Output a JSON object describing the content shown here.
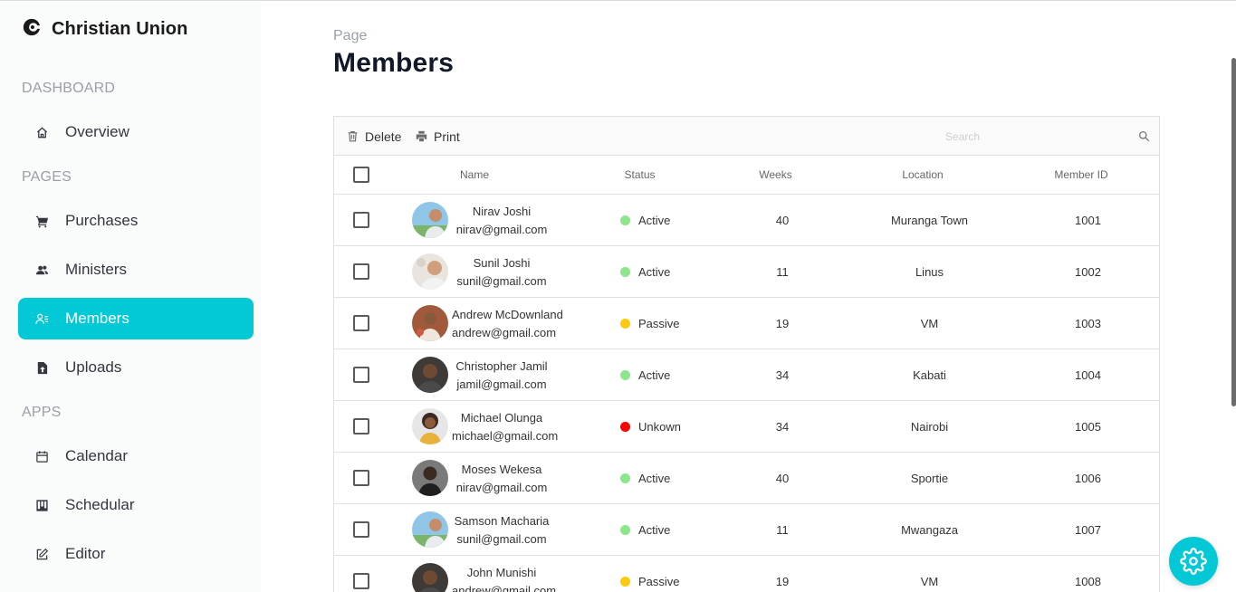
{
  "brand": {
    "name": "Christian Union",
    "icon": "logo-icon"
  },
  "sidebar": {
    "sections": [
      {
        "label": "DASHBOARD"
      },
      {
        "label": "PAGES"
      },
      {
        "label": "APPS"
      }
    ],
    "items": [
      {
        "label": "Overview",
        "icon": "home-icon"
      },
      {
        "label": "Purchases",
        "icon": "cart-icon"
      },
      {
        "label": "Ministers",
        "icon": "people-icon"
      },
      {
        "label": "Members",
        "icon": "member-list-icon",
        "active": true
      },
      {
        "label": "Uploads",
        "icon": "upload-icon"
      },
      {
        "label": "Calendar",
        "icon": "calendar-icon"
      },
      {
        "label": "Schedular",
        "icon": "kanban-icon"
      },
      {
        "label": "Editor",
        "icon": "edit-icon"
      }
    ],
    "active_color": "#03c9d7"
  },
  "header": {
    "kicker": "Page",
    "title": "Members"
  },
  "toolbar": {
    "delete_label": "Delete",
    "print_label": "Print",
    "search_placeholder": "Search"
  },
  "table": {
    "columns": [
      "Name",
      "Status",
      "Weeks",
      "Location",
      "Member ID"
    ],
    "rows": [
      {
        "name": "Nirav Joshi",
        "email": "nirav@gmail.com",
        "status": "Active",
        "weeks": "40",
        "location": "Muranga Town",
        "id": "1001"
      },
      {
        "name": "Sunil Joshi",
        "email": "sunil@gmail.com",
        "status": "Active",
        "weeks": "11",
        "location": "Linus",
        "id": "1002"
      },
      {
        "name": "Andrew McDownland",
        "email": "andrew@gmail.com",
        "status": "Passive",
        "weeks": "19",
        "location": "VM",
        "id": "1003"
      },
      {
        "name": "Christopher Jamil",
        "email": "jamil@gmail.com",
        "status": "Active",
        "weeks": "34",
        "location": "Kabati",
        "id": "1004"
      },
      {
        "name": "Michael Olunga",
        "email": "michael@gmail.com",
        "status": "Unkown",
        "weeks": "34",
        "location": "Nairobi",
        "id": "1005"
      },
      {
        "name": "Moses Wekesa",
        "email": "nirav@gmail.com",
        "status": "Active",
        "weeks": "40",
        "location": "Sportie",
        "id": "1006"
      },
      {
        "name": "Samson Macharia",
        "email": "sunil@gmail.com",
        "status": "Active",
        "weeks": "11",
        "location": "Mwangaza",
        "id": "1007"
      },
      {
        "name": "John Munishi",
        "email": "andrew@gmail.com",
        "status": "Passive",
        "weeks": "19",
        "location": "VM",
        "id": "1008"
      }
    ]
  },
  "status_colors": {
    "Active": "#8be78b",
    "Passive": "#fec90f",
    "Unkown": "#ff0000"
  },
  "settings_button": {
    "icon": "gear-icon",
    "color": "#03c9d7"
  }
}
